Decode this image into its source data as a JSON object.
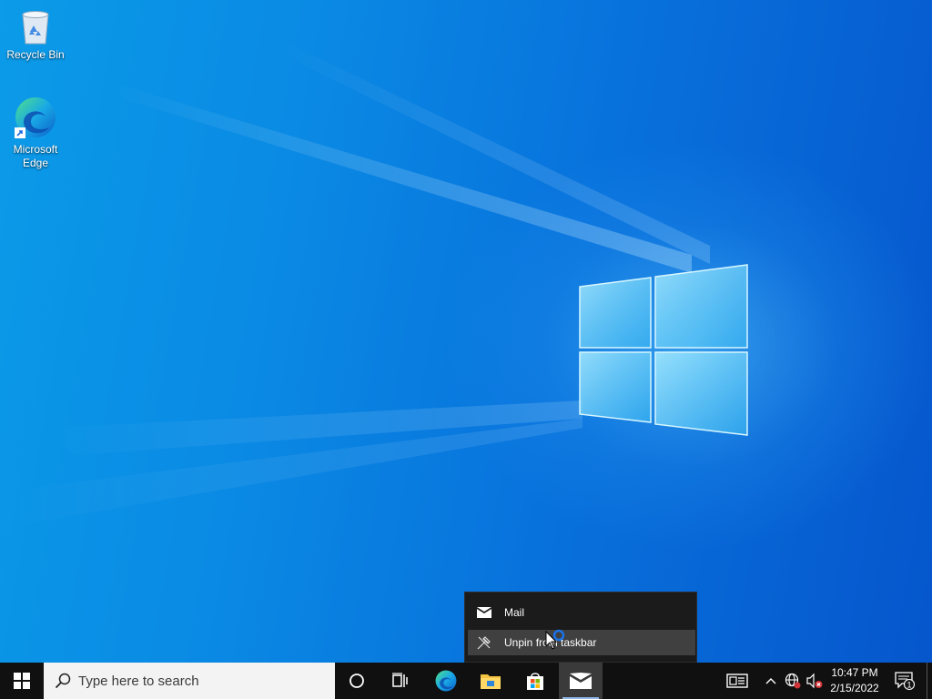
{
  "desktop": {
    "icons": [
      {
        "label": "Recycle Bin",
        "icon": "recycle-bin-icon"
      },
      {
        "label": "Microsoft Edge",
        "icon": "edge-icon"
      }
    ]
  },
  "taskbar": {
    "search": {
      "placeholder": "Type here to search"
    },
    "pinned_apps": [
      "Microsoft Edge",
      "File Explorer",
      "Microsoft Store",
      "Mail"
    ],
    "active_app": "Mail"
  },
  "jumplist": {
    "items": [
      {
        "label": "Mail",
        "icon": "mail-icon"
      },
      {
        "label": "Unpin from taskbar",
        "icon": "unpin-icon",
        "highlighted": true
      }
    ]
  },
  "tray": {
    "time": "10:47 PM",
    "date": "2/15/2022",
    "notification_count": "1",
    "volume_muted": true
  },
  "colors": {
    "accent": "#0a62d6",
    "taskbar": "#101010",
    "jumplist_bg": "#1b1b1b",
    "jumplist_highlight": "#404040"
  }
}
